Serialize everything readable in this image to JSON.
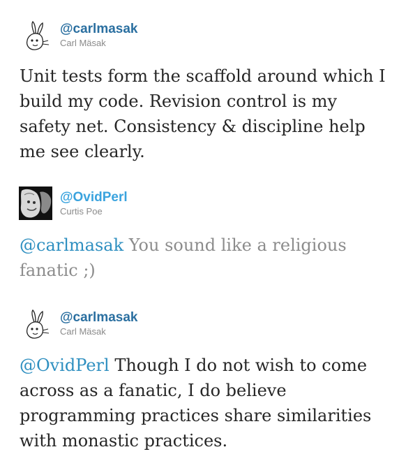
{
  "tweets": [
    {
      "handle": "@carlmasak",
      "name": "Carl Mäsak",
      "mention": "",
      "text": "Unit tests form the scaffold around which I build my code. Revision control is my safety net. Consistency & discipline help me see clearly.",
      "avatar": "rabbit-sketch-icon"
    },
    {
      "handle": "@OvidPerl",
      "name": "Curtis Poe",
      "mention": "@carlmasak",
      "text": " You sound like a religious fanatic ;)",
      "avatar": "photo-avatar"
    },
    {
      "handle": "@carlmasak",
      "name": "Carl Mäsak",
      "mention": "@OvidPerl",
      "text": " Though I do not wish to come across as a fanatic, I do believe programming practices share similarities with monastic practices.",
      "avatar": "rabbit-sketch-icon"
    }
  ],
  "colors": {
    "handle_primary": "#2a6fa0",
    "handle_secondary": "#3aa3de",
    "mention": "#2e8fc0",
    "text_dark": "#262626",
    "text_grey": "#8c8c8c",
    "name_grey": "#8a8a8a"
  }
}
